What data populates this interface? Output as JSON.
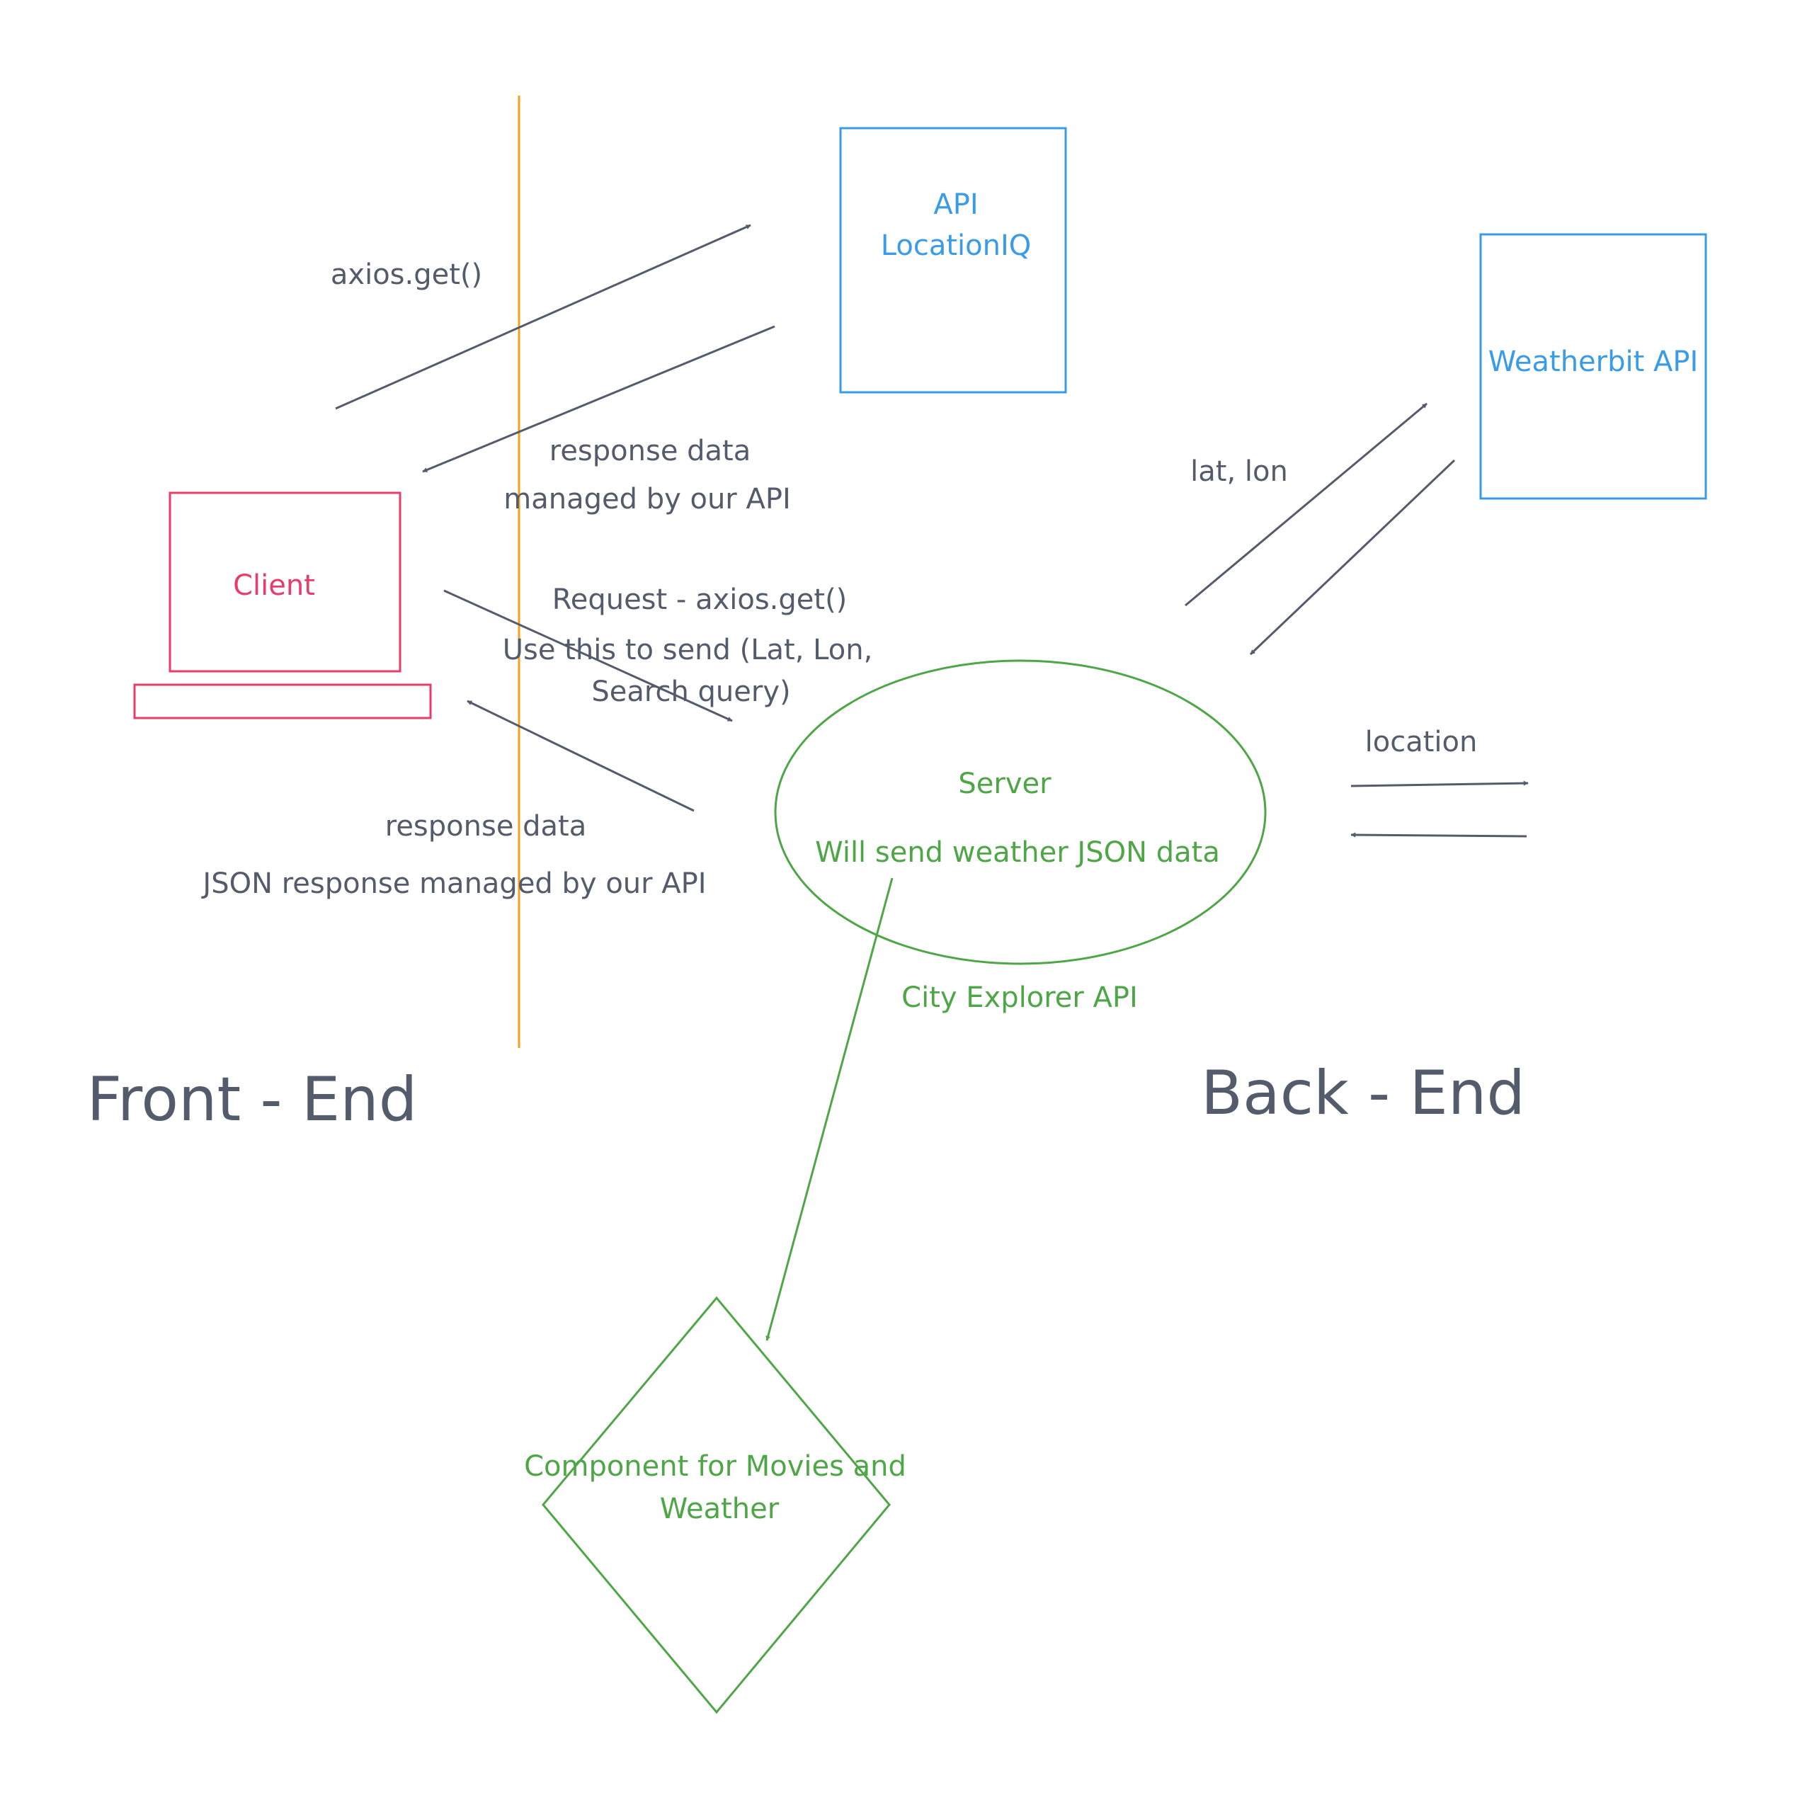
{
  "colors": {
    "text": "#545b6b",
    "divider": "#f3a01d",
    "api_box": "#3a9be6",
    "client": "#e63d6b",
    "server": "#4ea646"
  },
  "locationiq": {
    "line1": "API",
    "line2": "LocationIQ"
  },
  "weatherbit": {
    "label": "Weatherbit API"
  },
  "client": {
    "label": "Client"
  },
  "server": {
    "label": "Server",
    "sublabel": "Will send weather JSON data",
    "caption": "City Explorer API"
  },
  "component": {
    "line1": "Component for Movies and",
    "line2": "Weather"
  },
  "edges": {
    "axios_get": "axios.get()",
    "locationiq_response_1": "response data",
    "locationiq_response_2": "managed by our API",
    "request_1": "Request - axios.get()",
    "request_2": "Use this to send (Lat, Lon,",
    "request_3": "Search query)",
    "server_response_1": "response data",
    "server_response_2": "JSON response managed by our API",
    "lat_lon": "lat, lon",
    "location": "location"
  },
  "sections": {
    "front_end": "Front - End",
    "back_end": "Back - End"
  }
}
